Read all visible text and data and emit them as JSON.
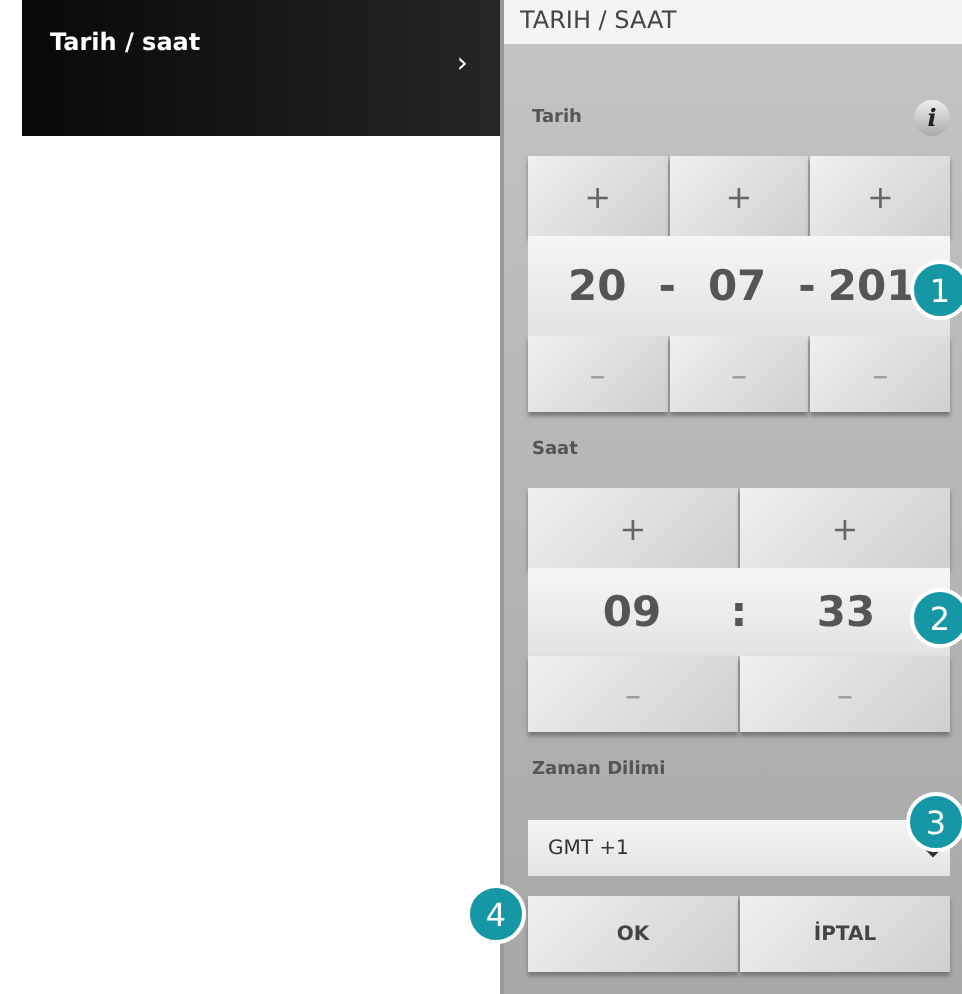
{
  "menu": {
    "item": "Tarih / saat",
    "chevron": "›"
  },
  "panel": {
    "title": "TARIH / SAAT",
    "date": {
      "label": "Tarih",
      "info": "i",
      "plus": [
        "+",
        "+",
        "+"
      ],
      "parts": [
        "20",
        "07",
        "201"
      ],
      "separators": [
        "-",
        "-"
      ],
      "minus": [
        "–",
        "–",
        "–"
      ],
      "badge": "1"
    },
    "time": {
      "label": "Saat",
      "plus": [
        "+",
        "+"
      ],
      "parts": [
        "09",
        "33"
      ],
      "separator": ":",
      "minus": [
        "–",
        "–"
      ],
      "badge": "2"
    },
    "zone": {
      "label": "Zaman Dilimi",
      "value": "GMT +1",
      "badge": "3"
    },
    "buttons": [
      {
        "label": "OK",
        "badge": "4"
      },
      {
        "label": "İPTAL"
      }
    ]
  }
}
